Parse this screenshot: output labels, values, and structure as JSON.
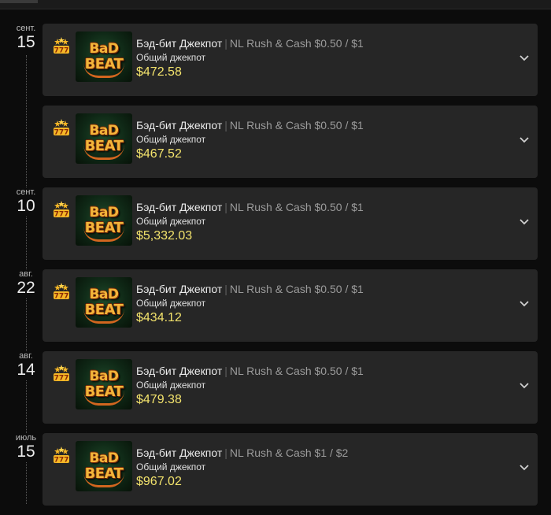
{
  "items": [
    {
      "month": "сент.",
      "day": "15",
      "title": "Бэд-бит Джекпот",
      "table": "NL Rush & Cash $0.50 / $1",
      "label": "Общий джекпот",
      "amount": "$472.58",
      "logo": {
        "l1": "BaD",
        "l2": "BEAT"
      }
    },
    {
      "month": "",
      "day": "",
      "title": "Бэд-бит Джекпот",
      "table": "NL Rush & Cash $0.50 / $1",
      "label": "Общий джекпот",
      "amount": "$467.52",
      "logo": {
        "l1": "BaD",
        "l2": "BEAT"
      }
    },
    {
      "month": "сент.",
      "day": "10",
      "title": "Бэд-бит Джекпот",
      "table": "NL Rush & Cash $0.50 / $1",
      "label": "Общий джекпот",
      "amount": "$5,332.03",
      "logo": {
        "l1": "BaD",
        "l2": "BEAT"
      }
    },
    {
      "month": "авг.",
      "day": "22",
      "title": "Бэд-бит Джекпот",
      "table": "NL Rush & Cash $0.50 / $1",
      "label": "Общий джекпот",
      "amount": "$434.12",
      "logo": {
        "l1": "BaD",
        "l2": "BEAT"
      }
    },
    {
      "month": "авг.",
      "day": "14",
      "title": "Бэд-бит Джекпот",
      "table": "NL Rush & Cash $0.50 / $1",
      "label": "Общий джекпот",
      "amount": "$479.38",
      "logo": {
        "l1": "BaD",
        "l2": "BEAT"
      }
    },
    {
      "month": "июль",
      "day": "15",
      "title": "Бэд-бит Джекпот",
      "table": "NL Rush & Cash $1 / $2",
      "label": "Общий джекпот",
      "amount": "$967.02",
      "logo": {
        "l1": "BaD",
        "l2": "BEAT"
      }
    }
  ],
  "icons": {
    "jackpot": "jackpot-777-icon",
    "expand": "chevron-down-icon"
  },
  "colors": {
    "amount": "#f3e36c",
    "card": "#262626",
    "background": "#0c0c0c"
  }
}
